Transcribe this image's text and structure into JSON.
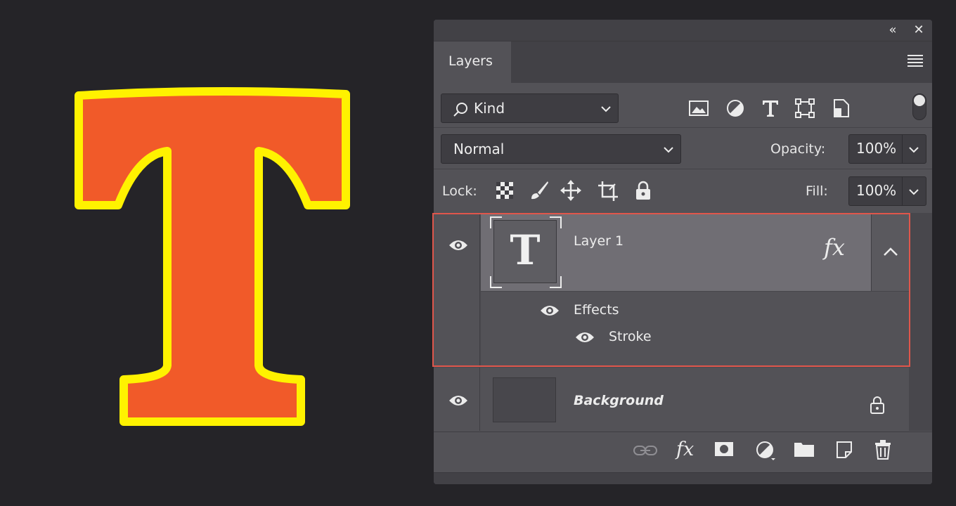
{
  "panel": {
    "tab_label": "Layers",
    "collapse_glyph": "«",
    "close_glyph": "✕"
  },
  "filter": {
    "kind_label": "Kind",
    "icons": [
      "image-filter-icon",
      "adjustment-filter-icon",
      "type-filter-icon",
      "shape-filter-icon",
      "smart-object-filter-icon"
    ]
  },
  "blend": {
    "mode": "Normal",
    "opacity_label": "Opacity:",
    "opacity_value": "100%"
  },
  "lock": {
    "label": "Lock:",
    "fill_label": "Fill:",
    "fill_value": "100%"
  },
  "layers": [
    {
      "name": "Layer 1",
      "type_glyph": "T",
      "fx_label": "fx",
      "effects_label": "Effects",
      "stroke_label": "Stroke"
    },
    {
      "name": "Background"
    }
  ],
  "footer": {
    "fx_label": "fx"
  },
  "colors": {
    "letter_fill": "#F15A29",
    "letter_stroke": "#FFF200",
    "selection_outline": "#E0564B",
    "canvas_background": "#252428"
  }
}
